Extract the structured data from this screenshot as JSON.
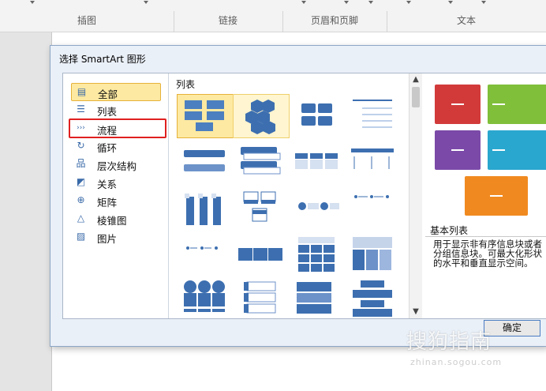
{
  "ribbon": {
    "groups": [
      "插图",
      "链接",
      "页眉和页脚",
      "文本"
    ]
  },
  "dialog": {
    "title": "选择 SmartArt 图形",
    "categories": [
      {
        "label": "全部",
        "icon": "all-icon"
      },
      {
        "label": "列表",
        "icon": "list-icon"
      },
      {
        "label": "流程",
        "icon": "process-icon"
      },
      {
        "label": "循环",
        "icon": "cycle-icon"
      },
      {
        "label": "层次结构",
        "icon": "hierarchy-icon"
      },
      {
        "label": "关系",
        "icon": "relationship-icon"
      },
      {
        "label": "矩阵",
        "icon": "matrix-icon"
      },
      {
        "label": "棱锥图",
        "icon": "pyramid-icon"
      },
      {
        "label": "图片",
        "icon": "picture-icon"
      }
    ],
    "selected_category": "全部",
    "highlighted_category": "流程",
    "gallery_header": "列表",
    "preview": {
      "name": "基本列表",
      "description": "用于显示非有序信息块或者分组信息块。可最大化形状的水平和垂直显示空间。"
    },
    "ok_label": "确定"
  },
  "colors": {
    "accent_red": "#d23a3a",
    "accent_green": "#7fbf3a",
    "accent_purple": "#7b4aa8",
    "accent_cyan": "#2aa7cf",
    "accent_orange": "#f08a20",
    "highlight_border": "#e02020",
    "selection_fill": "#fde9a1"
  },
  "watermark": {
    "text": "搜狗指南",
    "url": "zhinan.sogou.com"
  }
}
